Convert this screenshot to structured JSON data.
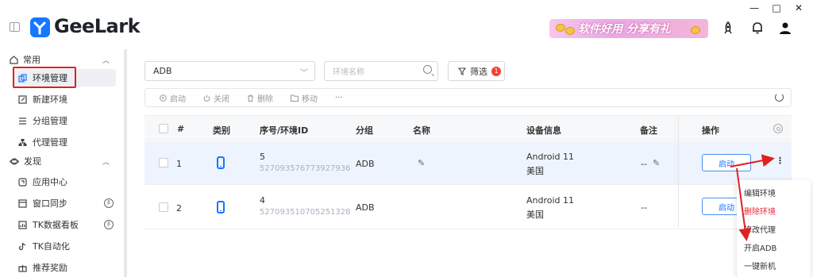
{
  "app": {
    "logo_text": "GeeLark",
    "promo_text": "软件好用 分享有礼",
    "window_controls": [
      "—",
      "□",
      "✕"
    ]
  },
  "sidebar": {
    "groups": [
      {
        "label": "常用",
        "icon": "home-icon"
      },
      {
        "label": "发现",
        "icon": "planet-icon"
      }
    ],
    "items": [
      {
        "label": "环境管理",
        "icon": "copy-icon",
        "active": true
      },
      {
        "label": "新建环境",
        "icon": "edit-icon"
      },
      {
        "label": "分组管理",
        "icon": "list-icon"
      },
      {
        "label": "代理管理",
        "icon": "network-icon"
      },
      {
        "label": "应用中心",
        "icon": "app-icon"
      },
      {
        "label": "窗口同步",
        "icon": "window-icon",
        "badge": "β"
      },
      {
        "label": "TK数据看板",
        "icon": "dashboard-icon",
        "badge": "β"
      },
      {
        "label": "TK自动化",
        "icon": "tiktok-icon"
      },
      {
        "label": "推荐奖励",
        "icon": "gift-icon"
      }
    ]
  },
  "filters": {
    "select_value": "ADB",
    "search_placeholder": "环境名称",
    "filter_label": "筛选",
    "filter_count": "1"
  },
  "toolbar": {
    "start": "启动",
    "close": "关闭",
    "delete": "删除",
    "move": "移动",
    "more": "···"
  },
  "table": {
    "headers": {
      "index": "#",
      "type": "类别",
      "serial_id": "序号/环境ID",
      "group": "分组",
      "name": "名称",
      "device": "设备信息",
      "remark": "备注",
      "actions": "操作"
    },
    "rows": [
      {
        "index": "1",
        "serial": "5",
        "env_id": "527093576773927936",
        "group": "ADB",
        "os": "Android 11",
        "region": "美国",
        "remark": "--",
        "action": "启动"
      },
      {
        "index": "2",
        "serial": "4",
        "env_id": "527093510705251328",
        "group": "ADB",
        "os": "Android 11",
        "region": "美国",
        "remark": "--",
        "action": "启动"
      }
    ]
  },
  "context_menu": {
    "items": [
      {
        "label": "编辑环境"
      },
      {
        "label": "删除环境",
        "danger": true
      },
      {
        "label": "修改代理"
      },
      {
        "label": "开启ADB"
      },
      {
        "label": "一键新机"
      }
    ]
  },
  "colors": {
    "accent": "#1677ff",
    "highlight_red": "#e02020",
    "danger": "#ee2233"
  }
}
